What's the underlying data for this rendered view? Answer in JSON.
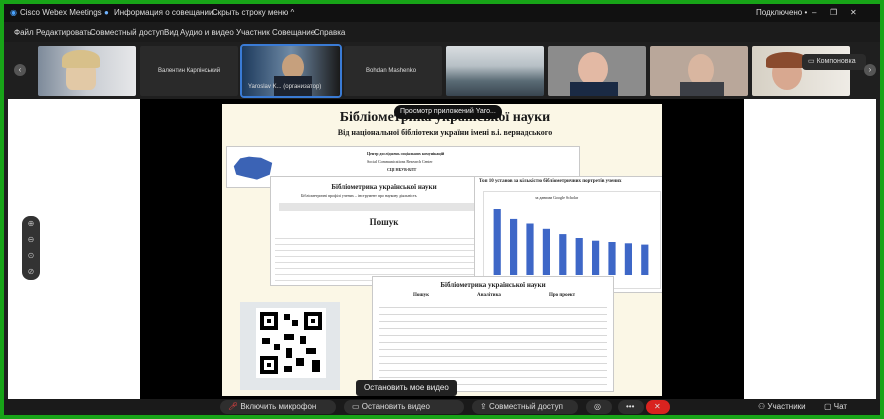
{
  "titlebar": {
    "app": "Cisco Webex Meetings",
    "info": "Информация о совещании",
    "hide_menu": "Скрыть строку меню ^",
    "status": "Подключено •"
  },
  "menu": [
    "Файл",
    "Редактировать",
    "Совместный доступ",
    "Вид",
    "Аудио и видео",
    "Участник",
    "Совещание",
    "Справка"
  ],
  "participants": [
    {
      "name": ""
    },
    {
      "name": "Валентин Карпінський"
    },
    {
      "name": "Yaroslav K... (организатор)"
    },
    {
      "name": "Bohdan Mashenko"
    },
    {
      "name": ""
    },
    {
      "name": ""
    },
    {
      "name": ""
    },
    {
      "name": ""
    }
  ],
  "layout_button": "Компоновка",
  "tooltip": "Просмотр приложений Yaro...",
  "poster": {
    "title": "Бібліометрика української науки",
    "subtitle": "Від національної бібліотеки україни імені в.і. вернадського",
    "center_name": "Центр досліджень соціальних комунікацій",
    "center_en": "Social Communications Research Center",
    "center_code": "СЦІ НБУВ-ВЛТ",
    "mid_title": "Бібліометрика української науки",
    "mid_sub": "Бібліометричні профілі учених – інструмент про наукову діяльність",
    "search_title": "Пошук",
    "chart_title": "Топ 10 установ за кількістю бібліометричних портретів учених",
    "chart_legend": "за даними Google Scholar",
    "lower_title": "Бібліометрика української науки",
    "col1": "Пошук",
    "col2": "Аналітика",
    "col3": "Про проект"
  },
  "chart_data": {
    "type": "bar",
    "title": "Топ 10 установ за кількістю бібліометричних портретів учених",
    "values": [
      100,
      85,
      78,
      70,
      62,
      56,
      52,
      50,
      48,
      46
    ]
  },
  "bottom": {
    "stop_video": "Остановить мое видео",
    "mic": "Включить микрофон",
    "video": "Остановить видео",
    "share": "Совместный доступ",
    "participants": "Участники",
    "chat": "Чат"
  }
}
